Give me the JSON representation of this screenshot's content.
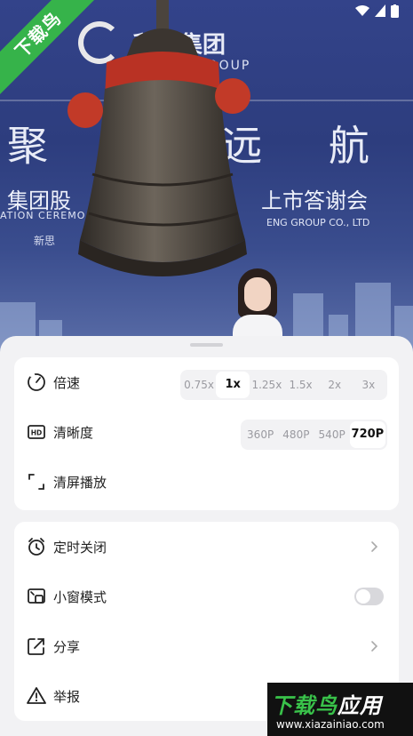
{
  "video": {
    "company_name": "积乐集团",
    "company_sub": "GROUP",
    "slogan": "聚 梦 远 航",
    "event_title_left": "集团股",
    "event_title_right": "上市答谢会",
    "ceremony_en_left": "ATION CEREMO",
    "ceremony_en_right": "ENG GROUP CO., LTD",
    "sub_caption": "新思"
  },
  "watermark": {
    "ribbon_text": "下载鸟",
    "promo_title_a": "下载鸟",
    "promo_title_b": "应用",
    "promo_url": "www.xiazainiao.com"
  },
  "sheet": {
    "speed": {
      "label": "倍速",
      "options": [
        "0.75x",
        "1x",
        "1.25x",
        "1.5x",
        "2x",
        "3x"
      ],
      "selected": "1x"
    },
    "quality": {
      "label": "清晰度",
      "options": [
        "360P",
        "480P",
        "540P",
        "720P"
      ],
      "selected": "720P"
    },
    "clean_screen": {
      "label": "清屏播放"
    },
    "timer": {
      "label": "定时关闭"
    },
    "mini_window": {
      "label": "小窗模式",
      "enabled": false
    },
    "share": {
      "label": "分享"
    },
    "report": {
      "label": "举报"
    }
  }
}
